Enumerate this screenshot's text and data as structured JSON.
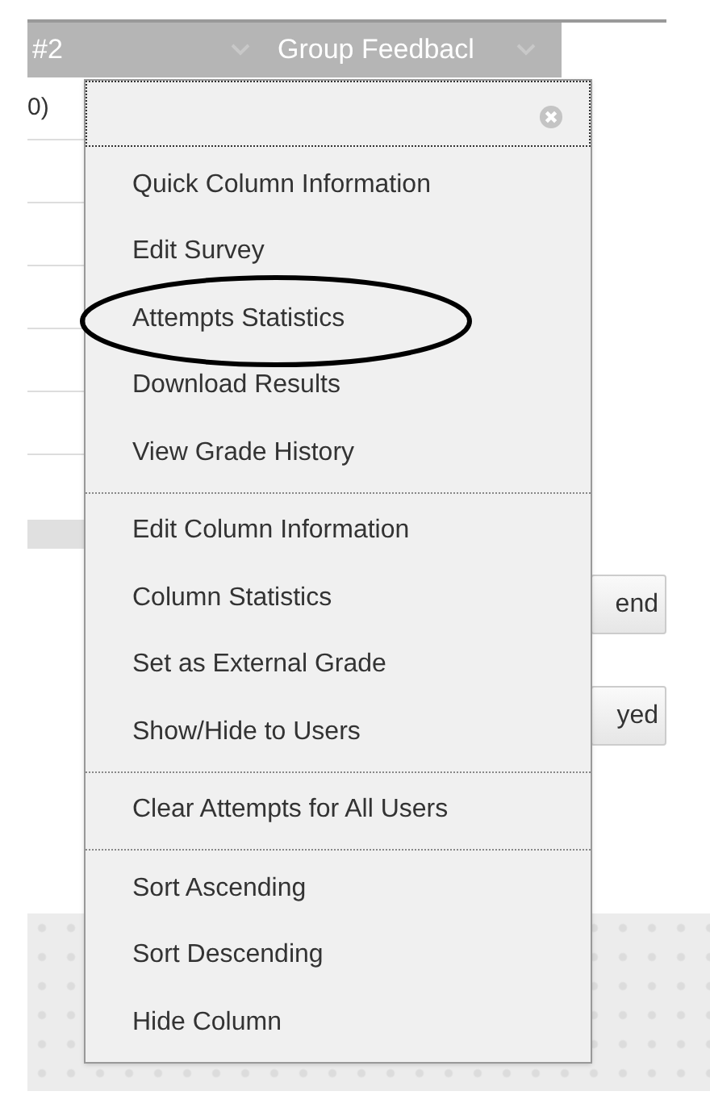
{
  "grid": {
    "columns": [
      {
        "label": "#2"
      },
      {
        "label": "Group Feedbacl"
      }
    ],
    "cell": "0)",
    "buttons": [
      "end",
      "yed"
    ]
  },
  "menu": {
    "sections": [
      {
        "items": [
          {
            "label": "Quick Column Information",
            "circled": false
          },
          {
            "label": "Edit Survey",
            "circled": false
          },
          {
            "label": "Attempts Statistics",
            "circled": true
          },
          {
            "label": "Download Results",
            "circled": false
          },
          {
            "label": "View Grade History",
            "circled": false
          }
        ]
      },
      {
        "items": [
          {
            "label": "Edit Column Information",
            "circled": false
          },
          {
            "label": "Column Statistics",
            "circled": false
          },
          {
            "label": "Set as External Grade",
            "circled": false
          },
          {
            "label": "Show/Hide to Users",
            "circled": false
          }
        ]
      },
      {
        "items": [
          {
            "label": "Clear Attempts for All Users",
            "circled": false
          }
        ]
      },
      {
        "items": [
          {
            "label": "Sort Ascending",
            "circled": false
          },
          {
            "label": "Sort Descending",
            "circled": false
          },
          {
            "label": "Hide Column",
            "circled": false
          }
        ]
      }
    ]
  }
}
